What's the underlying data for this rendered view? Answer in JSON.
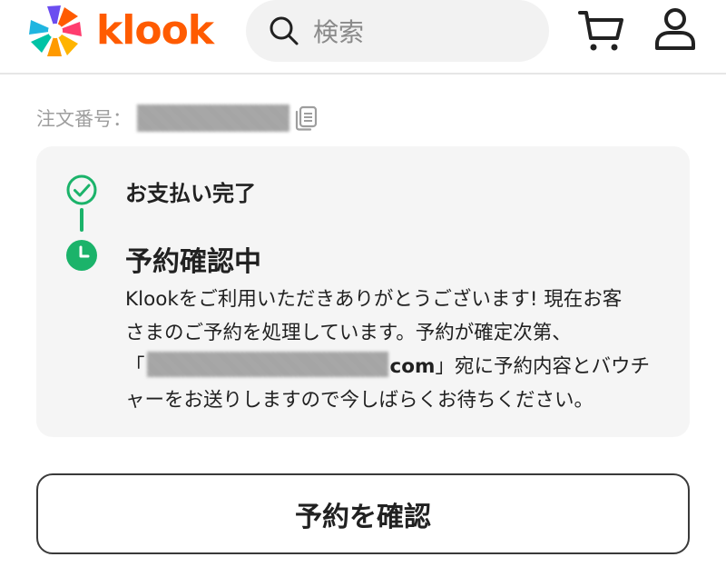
{
  "header": {
    "brand": "klook",
    "search": {
      "placeholder": "検索"
    },
    "icons": [
      "search-icon",
      "cart-icon",
      "user-icon"
    ],
    "accent_color": "#ff5b00"
  },
  "order": {
    "number_label": "注文番号："
  },
  "status": {
    "step1": {
      "label": "お支払い完了",
      "icon": "check-circle-icon",
      "color": "#1bb36a"
    },
    "step2": {
      "label": "予約確認中",
      "icon": "clock-icon",
      "color": "#1bb36a"
    },
    "message": {
      "line1": "Klookをご利用いただきありがとうございます! 現在お客",
      "line2": "さまのご予約を処理しています。予約が確定次第、",
      "line3_prefix": "「",
      "line3_email_suffix": "com",
      "line3_rest": "」宛に予約内容とバウチ",
      "line4": "ャーをお送りしますので今しばらくお待ちください。"
    }
  },
  "actions": {
    "confirm_label": "予約を確認"
  }
}
